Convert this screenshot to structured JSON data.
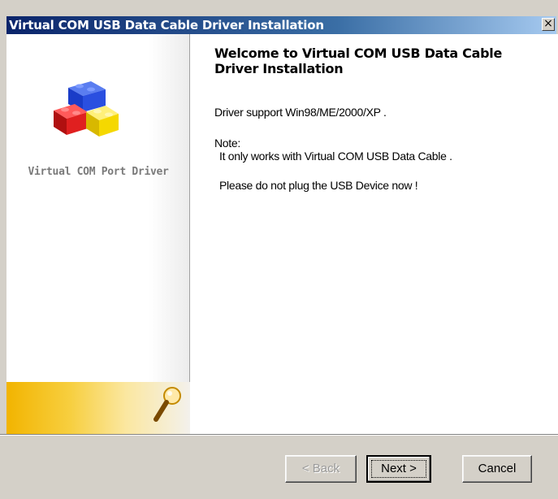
{
  "window": {
    "title": "Virtual COM USB Data Cable Driver Installation",
    "close_label": "×"
  },
  "sidebar": {
    "caption": "Virtual COM Port Driver",
    "logo_icon": "lego-blocks-icon",
    "bottom_icon": "magnifier-icon"
  },
  "main": {
    "heading": "Welcome to Virtual COM USB Data Cable Driver Installation",
    "support": "Driver support Win98/ME/2000/XP .",
    "note_label": "Note:",
    "note_text": "It only works with  Virtual COM USB Data Cable .",
    "warning": "Please do not plug the USB Device now !"
  },
  "buttons": {
    "back": "< Back",
    "next": "Next >",
    "cancel": "Cancel"
  },
  "colors": {
    "title_bar_start": "#0a246a",
    "title_bar_end": "#a6caf0",
    "dialog_face": "#d4d0c8",
    "accent_gold": "#f2b400"
  }
}
